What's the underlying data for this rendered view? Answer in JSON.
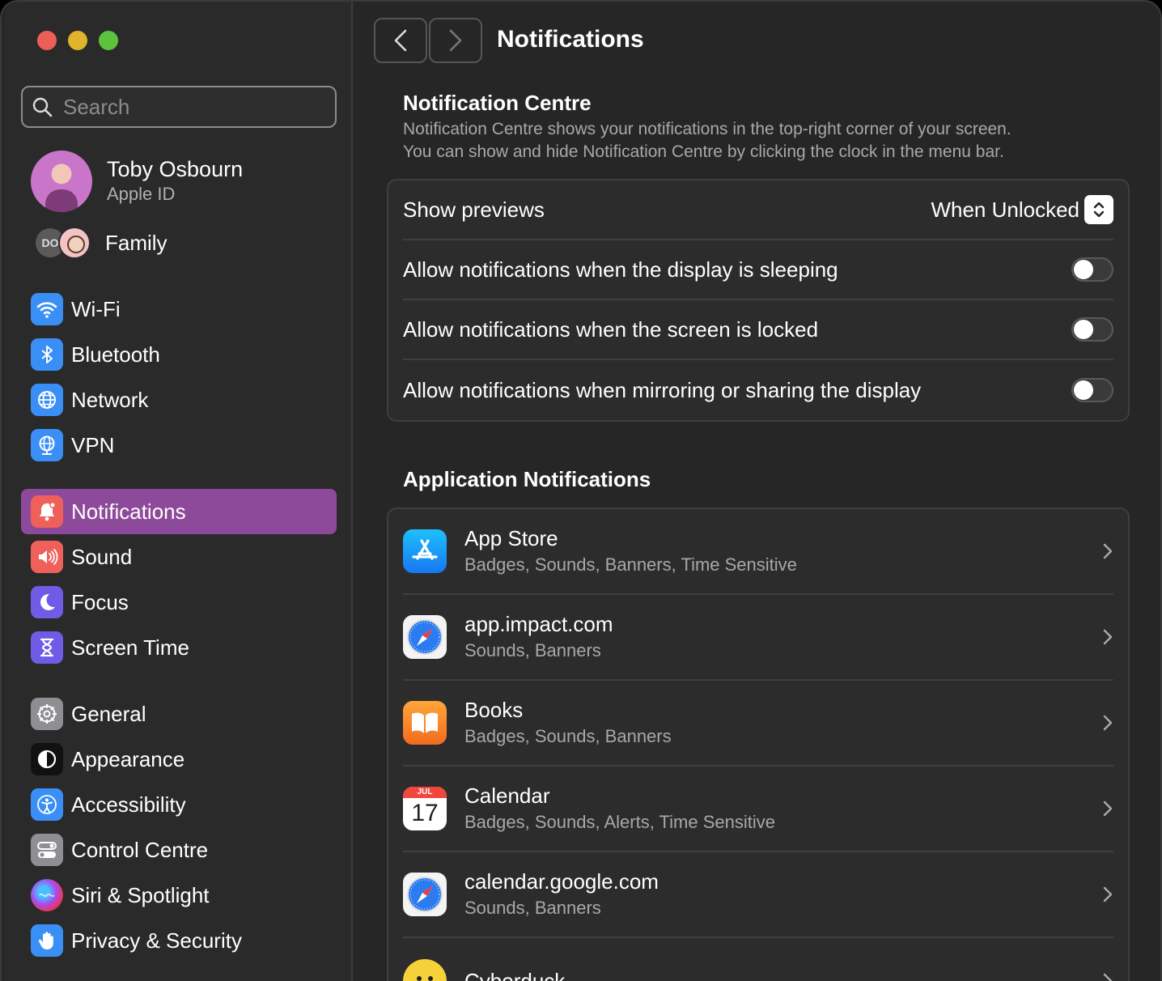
{
  "window": {
    "traffic_lights": {
      "close": "#ec5f57",
      "minimize": "#e0b32c",
      "zoom": "#5cc33d"
    }
  },
  "sidebar": {
    "search_placeholder": "Search",
    "profile": {
      "name": "Toby Osbourn",
      "sub": "Apple ID"
    },
    "family": {
      "initials": "DO",
      "label": "Family"
    },
    "items": [
      {
        "label": "Wi-Fi",
        "icon": "wifi-icon",
        "color": "#3a8ff7"
      },
      {
        "label": "Bluetooth",
        "icon": "bluetooth-icon",
        "color": "#3a8ff7"
      },
      {
        "label": "Network",
        "icon": "globe-icon",
        "color": "#3a8ff7"
      },
      {
        "label": "VPN",
        "icon": "vpn-globe-icon",
        "color": "#3a8ff7"
      },
      {
        "label": "Notifications",
        "icon": "bell-icon",
        "color": "#f0605a"
      },
      {
        "label": "Sound",
        "icon": "speaker-icon",
        "color": "#f0605a"
      },
      {
        "label": "Focus",
        "icon": "moon-icon",
        "color": "#6e5ce6"
      },
      {
        "label": "Screen Time",
        "icon": "hourglass-icon",
        "color": "#6e5ce6"
      },
      {
        "label": "General",
        "icon": "gear-icon",
        "color": "#8e8e93"
      },
      {
        "label": "Appearance",
        "icon": "appearance-icon",
        "color": "#1c1c1e"
      },
      {
        "label": "Accessibility",
        "icon": "accessibility-icon",
        "color": "#3a8ff7"
      },
      {
        "label": "Control Centre",
        "icon": "switches-icon",
        "color": "#8e8e93"
      },
      {
        "label": "Siri & Spotlight",
        "icon": "siri-icon",
        "color": "#222"
      },
      {
        "label": "Privacy & Security",
        "icon": "hand-icon",
        "color": "#3a8ff7"
      }
    ],
    "active": "Notifications",
    "active_color": "#8e4a9a"
  },
  "main": {
    "title": "Notifications",
    "notification_centre": {
      "title": "Notification Centre",
      "desc_line1": "Notification Centre shows your notifications in the top-right corner of your screen.",
      "desc_line2": "You can show and hide Notification Centre by clicking the clock in the menu bar.",
      "show_previews_label": "Show previews",
      "show_previews_value": "When Unlocked",
      "toggles": [
        {
          "label": "Allow notifications when the display is sleeping",
          "on": false
        },
        {
          "label": "Allow notifications when the screen is locked",
          "on": false
        },
        {
          "label": "Allow notifications when mirroring or sharing the display",
          "on": false
        }
      ]
    },
    "app_notifications": {
      "title": "Application Notifications",
      "apps": [
        {
          "name": "App Store",
          "sub": "Badges, Sounds, Banners, Time Sensitive",
          "icon": "app-store-icon"
        },
        {
          "name": "app.impact.com",
          "sub": "Sounds, Banners",
          "icon": "safari-icon"
        },
        {
          "name": "Books",
          "sub": "Badges, Sounds, Banners",
          "icon": "books-icon"
        },
        {
          "name": "Calendar",
          "sub": "Badges, Sounds, Alerts, Time Sensitive",
          "icon": "calendar-icon",
          "cal_month": "JUL",
          "cal_day": "17"
        },
        {
          "name": "calendar.google.com",
          "sub": "Sounds, Banners",
          "icon": "safari-icon"
        },
        {
          "name": "Cyberduck",
          "sub": "",
          "icon": "cyberduck-icon"
        }
      ]
    }
  }
}
